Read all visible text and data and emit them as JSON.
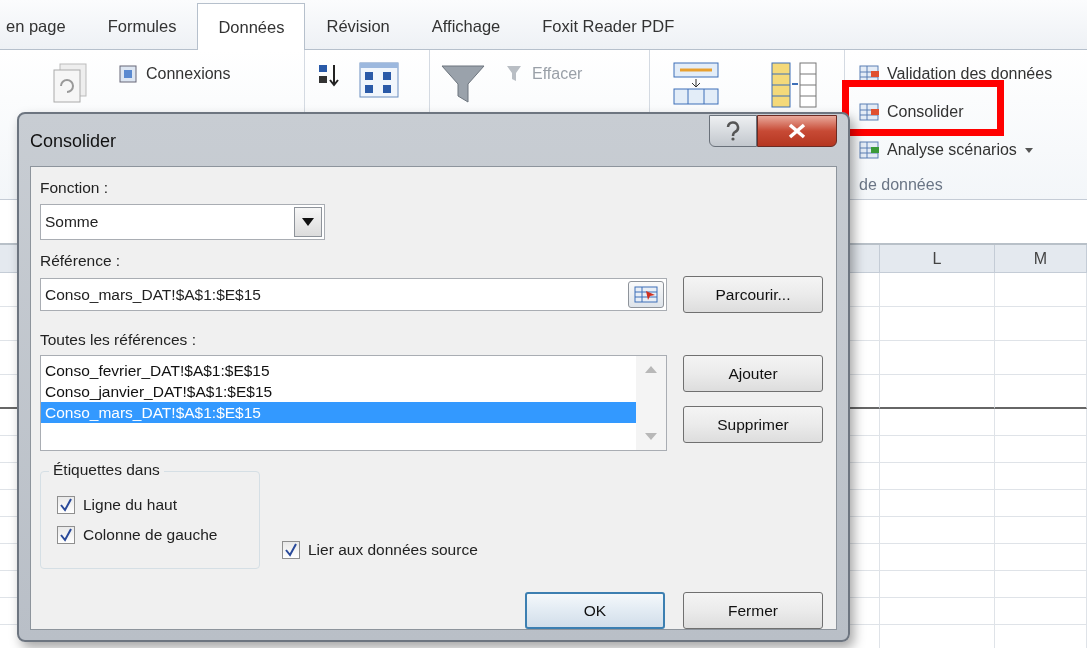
{
  "ribbon_tabs": [
    {
      "label": "en page",
      "selected": false
    },
    {
      "label": "Formules",
      "selected": false
    },
    {
      "label": "Données",
      "selected": true
    },
    {
      "label": "Révision",
      "selected": false
    },
    {
      "label": "Affichage",
      "selected": false
    },
    {
      "label": "Foxit Reader PDF",
      "selected": false
    }
  ],
  "ribbon": {
    "connections": [
      {
        "label": "Connexions",
        "disabled": false
      }
    ],
    "filter": [
      {
        "label": "Effacer",
        "disabled": true
      }
    ],
    "data_tools": [
      {
        "label": "Validation des données",
        "disabled": false,
        "highlighted": false,
        "dropdown": false
      },
      {
        "label": "Consolider",
        "disabled": false,
        "highlighted": true,
        "dropdown": false
      },
      {
        "label": "Analyse scénarios",
        "disabled": false,
        "highlighted": false,
        "dropdown": true
      }
    ],
    "group_label": "de données"
  },
  "sheet": {
    "columns": [
      "L",
      "M"
    ]
  },
  "dialog": {
    "title": "Consolider",
    "function_label": "Fonction :",
    "function_value": "Somme",
    "reference_label": "Référence :",
    "reference_value": "Conso_mars_DAT!$A$1:$E$15",
    "browse_button": "Parcourir...",
    "all_references_label": "Toutes les références :",
    "references": [
      {
        "text": "Conso_fevrier_DAT!$A$1:$E$15",
        "selected": false
      },
      {
        "text": "Conso_janvier_DAT!$A$1:$E$15",
        "selected": false
      },
      {
        "text": "Conso_mars_DAT!$A$1:$E$15",
        "selected": true
      }
    ],
    "add_button": "Ajouter",
    "delete_button": "Supprimer",
    "labels_group": {
      "title": "Étiquettes dans",
      "options": [
        {
          "label": "Ligne du haut",
          "checked": true
        },
        {
          "label": "Colonne de gauche",
          "checked": true
        }
      ]
    },
    "link_source": {
      "label": "Lier aux données source",
      "checked": true
    },
    "buttons": [
      {
        "label": "OK",
        "default": true
      },
      {
        "label": "Fermer",
        "default": false
      }
    ]
  }
}
